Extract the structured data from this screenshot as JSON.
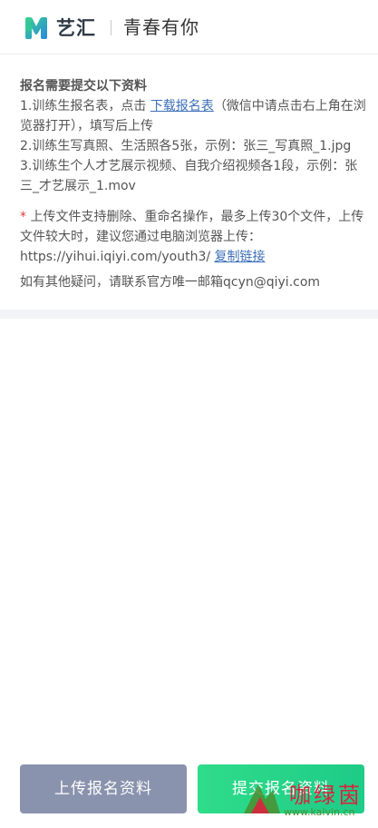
{
  "header": {
    "brand_name": "艺汇",
    "subtitle": "青春有你"
  },
  "notice": {
    "title": "报名需要提交以下资料",
    "item1_prefix": "1.训练生报名表，点击",
    "item1_link": "下载报名表",
    "item1_suffix": "（微信中请点击右上角在浏览器打开），填写后上传",
    "item2": "2.训练生写真照、生活照各5张，示例：张三_写真照_1.jpg",
    "item3": "3.训练生个人才艺展示视频、自我介绍视频各1段，示例：张三_才艺展示_1.mov",
    "tip_star": "*",
    "tip_text": " 上传文件支持删除、重命名操作，最多上传30个文件，上传文件较大时，建议您通过电脑浏览器上传：https://yihui.iqiyi.com/youth3/",
    "tip_link": "复制链接",
    "contact": "如有其他疑问，请联系官方唯一邮箱qcyn@qiyi.com"
  },
  "buttons": {
    "upload": "上传报名资料",
    "submit": "提交报名资料"
  },
  "watermark": {
    "text": "咖绿茵",
    "url": "www.kalvin.cn"
  },
  "colors": {
    "logo_green": "#2fd38a",
    "logo_blue": "#2c7be5",
    "link": "#3c6fb8",
    "upload_button": "#8a93ad",
    "submit_button": "#2fdc8a"
  }
}
